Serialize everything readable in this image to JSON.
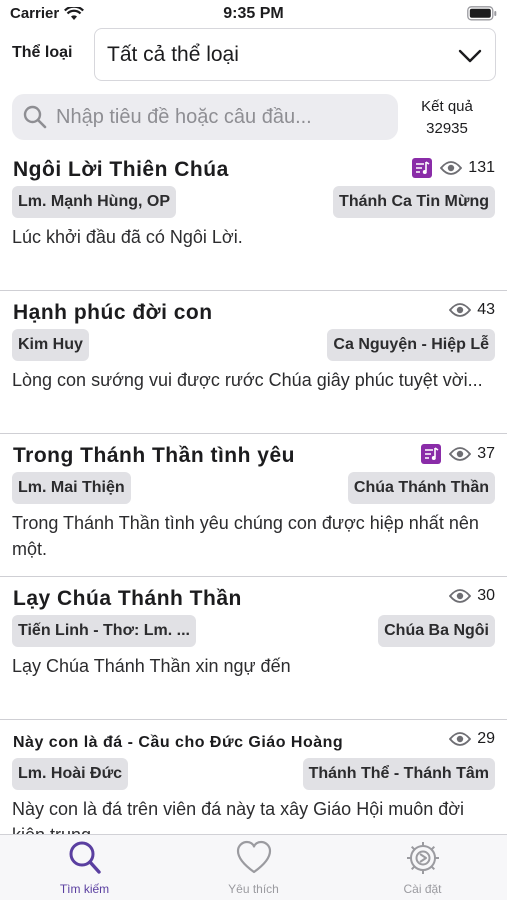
{
  "status": {
    "carrier": "Carrier",
    "time": "9:35 PM"
  },
  "filter": {
    "label": "Thể loại",
    "selected": "Tất cả thể loại"
  },
  "search": {
    "placeholder": "Nhập tiêu đề hoặc câu đầu..."
  },
  "results": {
    "label": "Kết quả",
    "count": "32935"
  },
  "songs": [
    {
      "title": "Ngôi Lời Thiên Chúa",
      "author": "Lm. Mạnh Hùng, OP",
      "category": "Thánh Ca Tin Mừng",
      "first_line": "Lúc khởi đầu đã có Ngôi Lời.",
      "views": "131",
      "has_music_badge": true
    },
    {
      "title": "Hạnh phúc đời con",
      "author": "Kim Huy",
      "category": "Ca Nguyện - Hiệp Lễ",
      "first_line": "Lòng con sướng vui được rước Chúa giây phúc tuyệt vời...",
      "views": "43",
      "has_music_badge": false
    },
    {
      "title": "Trong Thánh Thần tình yêu",
      "author": "Lm. Mai Thiện",
      "category": "Chúa Thánh Thần",
      "first_line": "Trong Thánh Thần tình yêu chúng con được hiệp nhất nên một.",
      "views": "37",
      "has_music_badge": true
    },
    {
      "title": "Lạy Chúa Thánh Thần",
      "author": "Tiến Linh - Thơ: Lm. ...",
      "category": "Chúa Ba Ngôi",
      "first_line": "Lạy Chúa Thánh Thần xin ngự đến",
      "views": "30",
      "has_music_badge": false
    },
    {
      "title": "Này con là đá  - Cầu cho Đức Giáo Hoàng",
      "author": "Lm. Hoài Đức",
      "category": "Thánh Thể - Thánh Tâm",
      "first_line": "Này con là đá trên viên đá này ta xây Giáo Hội muôn đời kiên trung",
      "views": "29",
      "has_music_badge": false
    }
  ],
  "tabs": [
    {
      "label": "Tìm kiếm",
      "icon": "search-icon",
      "active": true
    },
    {
      "label": "Yêu thích",
      "icon": "heart-icon",
      "active": false
    },
    {
      "label": "Cài đặt",
      "icon": "gear-icon",
      "active": false
    }
  ],
  "colors": {
    "accent": "#5a3fa0",
    "badge": "#8a2ca8",
    "tag_bg": "#e1e1e5"
  }
}
